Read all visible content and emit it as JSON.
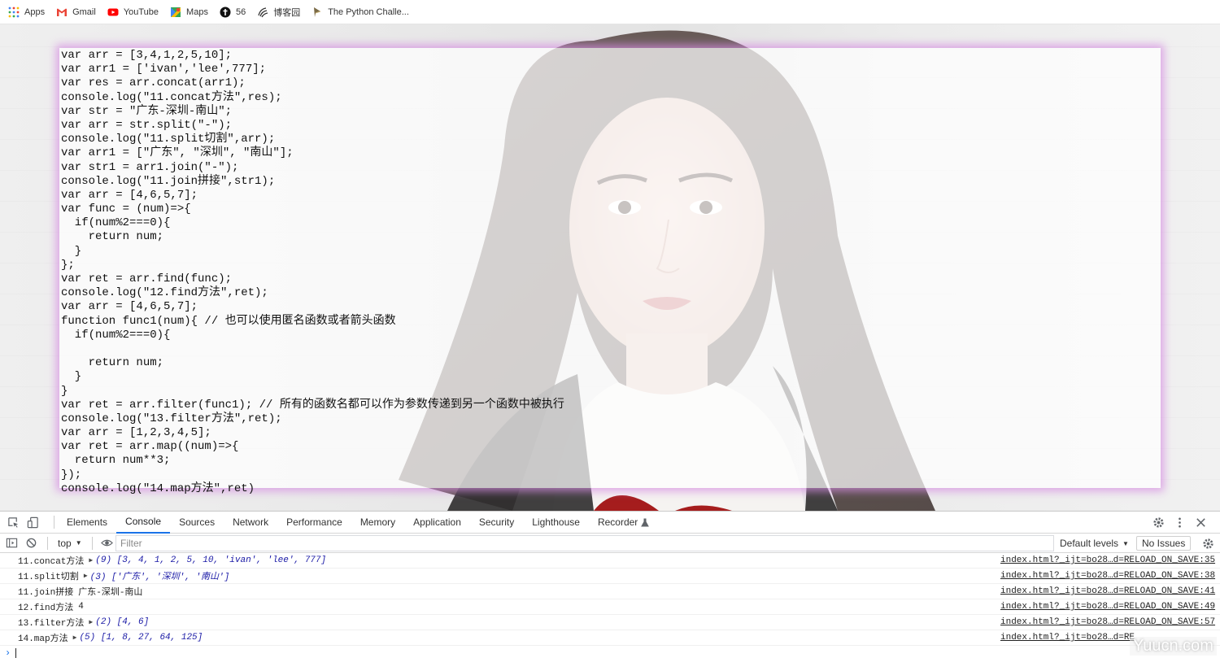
{
  "bookmarks": [
    {
      "label": "Apps",
      "icon": "apps-grid-icon"
    },
    {
      "label": "Gmail",
      "icon": "gmail-icon"
    },
    {
      "label": "YouTube",
      "icon": "youtube-icon"
    },
    {
      "label": "Maps",
      "icon": "maps-icon"
    },
    {
      "label": "56",
      "icon": "site-56-icon"
    },
    {
      "label": "博客园",
      "icon": "cnblogs-icon"
    },
    {
      "label": "The Python Challe...",
      "icon": "python-challenge-icon"
    }
  ],
  "code_lines": [
    "var arr = [3,4,1,2,5,10];",
    "var arr1 = ['ivan','lee',777];",
    "var res = arr.concat(arr1);",
    "console.log(\"11.concat方法\",res);",
    "var str = \"广东-深圳-南山\";",
    "var arr = str.split(\"-\");",
    "console.log(\"11.split切割\",arr);",
    "var arr1 = [\"广东\", \"深圳\", \"南山\"];",
    "var str1 = arr1.join(\"-\");",
    "console.log(\"11.join拼接\",str1);",
    "var arr = [4,6,5,7];",
    "var func = (num)=>{",
    "  if(num%2===0){",
    "    return num;",
    "  }",
    "};",
    "var ret = arr.find(func);",
    "console.log(\"12.find方法\",ret);",
    "var arr = [4,6,5,7];",
    "function func1(num){ // 也可以使用匿名函数或者箭头函数",
    "  if(num%2===0){",
    "",
    "    return num;",
    "  }",
    "}",
    "var ret = arr.filter(func1); // 所有的函数名都可以作为参数传递到另一个函数中被执行",
    "console.log(\"13.filter方法\",ret);",
    "var arr = [1,2,3,4,5];",
    "var ret = arr.map((num)=>{",
    "  return num**3;",
    "});",
    "console.log(\"14.map方法\",ret)"
  ],
  "devtools": {
    "tabs": [
      "Elements",
      "Console",
      "Sources",
      "Network",
      "Performance",
      "Memory",
      "Application",
      "Security",
      "Lighthouse",
      "Recorder"
    ],
    "active_tab": "Console",
    "context": "top",
    "filter_placeholder": "Filter",
    "levels": "Default levels",
    "issues": "No Issues"
  },
  "console_rows": [
    {
      "label": "11.concat方法",
      "expander": "▶",
      "value": "(9) [3, 4, 1, 2, 5, 10, 'ivan', 'lee', 777]",
      "source": "index.html?_ijt=bo28…d=RELOAD_ON_SAVE:35"
    },
    {
      "label": "11.split切割",
      "expander": "▶",
      "value": "(3) ['广东', '深圳', '南山']",
      "source": "index.html?_ijt=bo28…d=RELOAD_ON_SAVE:38"
    },
    {
      "label": "11.join拼接",
      "expander": "",
      "value": "广东-深圳-南山",
      "source": "index.html?_ijt=bo28…d=RELOAD_ON_SAVE:41"
    },
    {
      "label": "12.find方法",
      "expander": "",
      "value": "4",
      "source": "index.html?_ijt=bo28…d=RELOAD_ON_SAVE:49"
    },
    {
      "label": "13.filter方法",
      "expander": "▶",
      "value": "(2) [4, 6]",
      "source": "index.html?_ijt=bo28…d=RELOAD_ON_SAVE:57"
    },
    {
      "label": "14.map方法",
      "expander": "▶",
      "value": "(5) [1, 8, 27, 64, 125]",
      "source": "index.html?_ijt=bo28…d=RE"
    }
  ],
  "prompt_symbol": "›",
  "watermark": "Yuucn.com"
}
